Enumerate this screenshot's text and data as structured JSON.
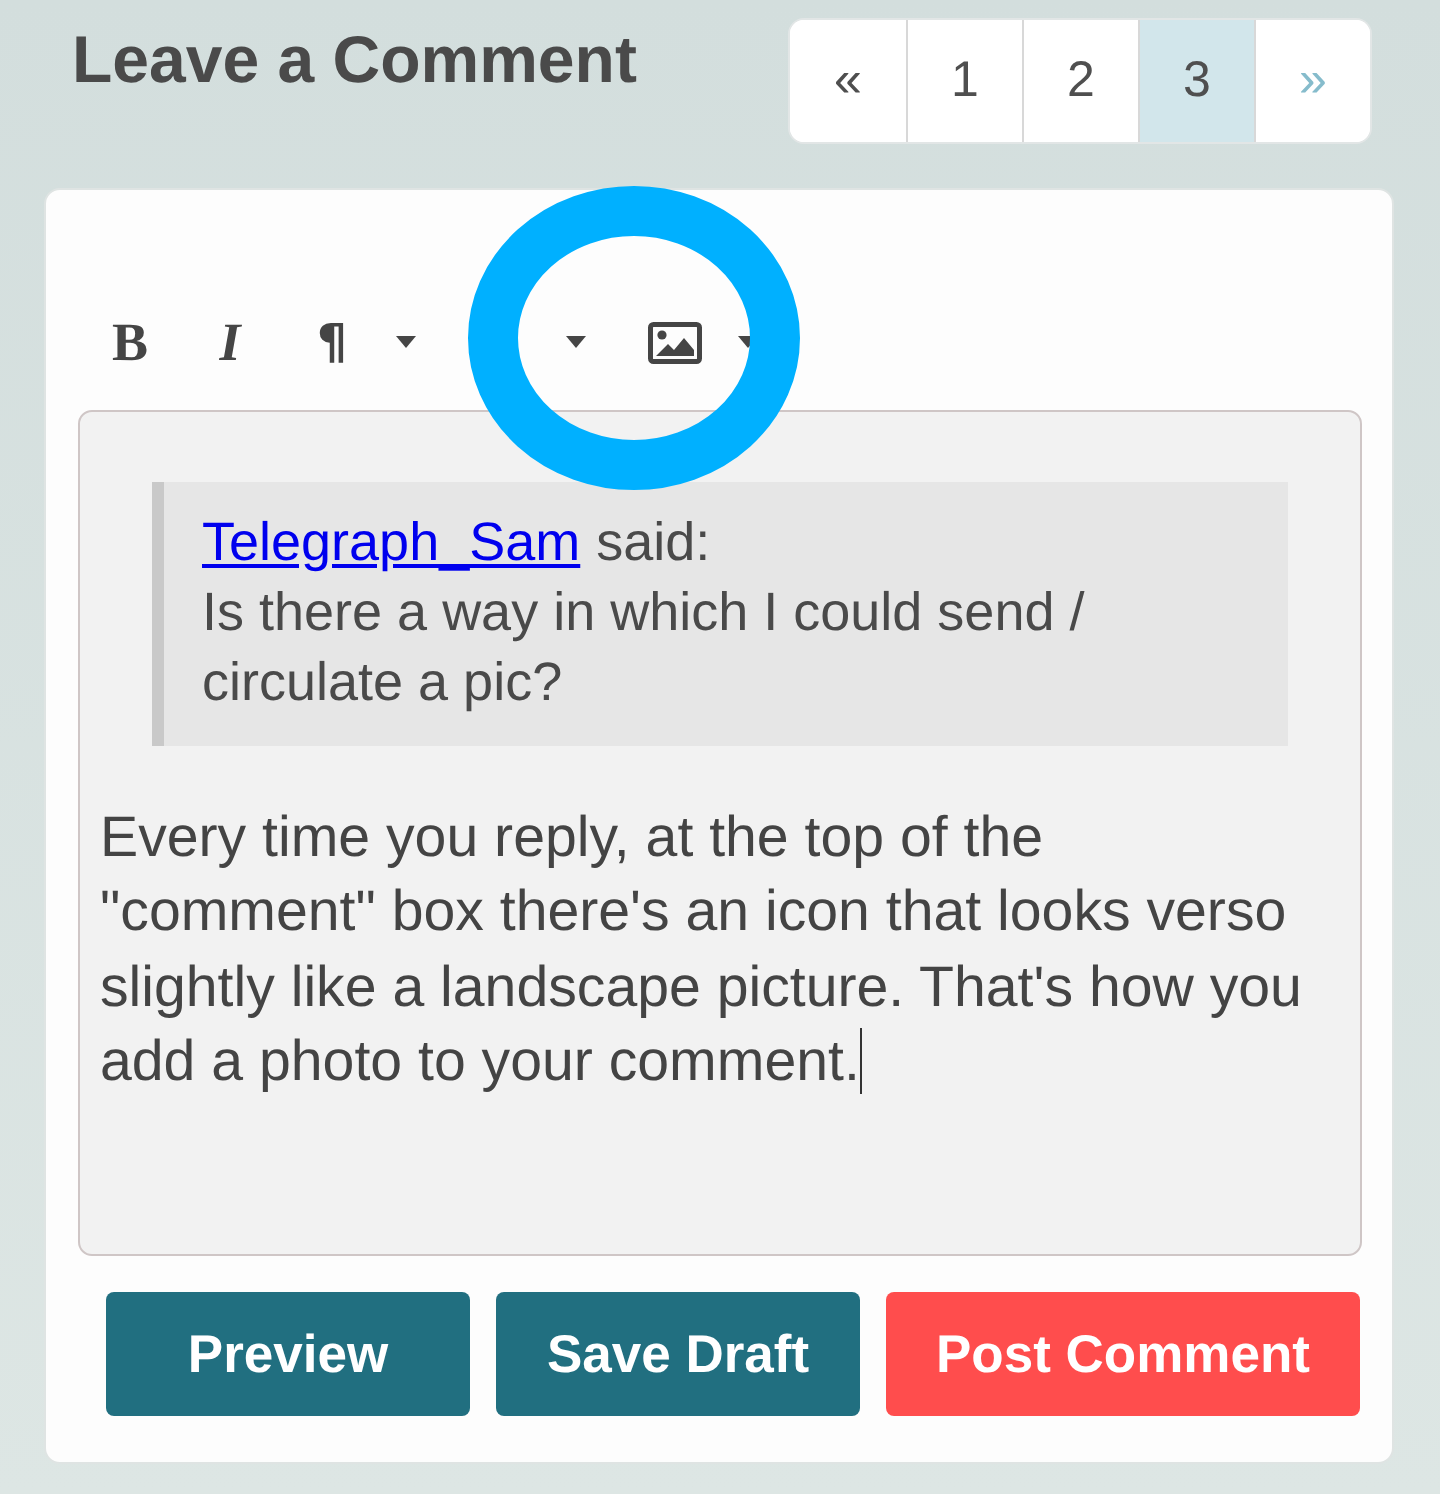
{
  "heading": "Leave a Comment",
  "pagination": [
    {
      "label": "«",
      "selected": false,
      "disabled": false
    },
    {
      "label": "1",
      "selected": false,
      "disabled": false
    },
    {
      "label": "2",
      "selected": false,
      "disabled": false
    },
    {
      "label": "3",
      "selected": true,
      "disabled": false
    },
    {
      "label": "»",
      "selected": false,
      "disabled": true
    }
  ],
  "toolbar": [
    {
      "kind": "bold",
      "label": "B",
      "dropdown": false
    },
    {
      "kind": "italic",
      "label": "I",
      "dropdown": false
    },
    {
      "kind": "paragraph",
      "label": "¶",
      "dropdown": true
    },
    {
      "kind": "blank",
      "dropdown": true
    },
    {
      "kind": "image",
      "dropdown": true
    }
  ],
  "editor": {
    "quote": {
      "author": "Telegraph_Sam",
      "said": "said:",
      "text": "Is there a way in which I could send / circulate a pic?"
    },
    "body": "Every time you reply, at the top of the \"comment\" box there's an icon that looks verso slightly like a landscape picture. That's how you add a photo to your comment.",
    "cursor": true
  },
  "buttons": [
    {
      "label": "Preview",
      "kind": "secondary"
    },
    {
      "label": "Save Draft",
      "kind": "secondary"
    },
    {
      "label": "Post Comment",
      "kind": "primary"
    }
  ]
}
